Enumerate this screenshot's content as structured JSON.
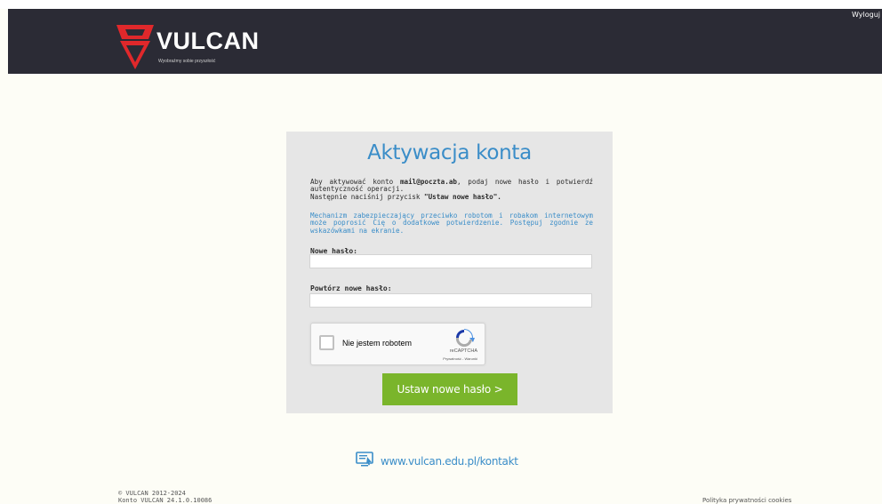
{
  "header": {
    "logout_label": "Wyloguj",
    "brand_name": "VULCAN",
    "brand_slogan": "Wyobraźmy sobie przyszłość"
  },
  "card": {
    "title": "Aktywacja konta",
    "intro_part1": "Aby aktywować konto ",
    "intro_email": "mail@poczta.ab",
    "intro_part2": ", podaj nowe hasło i potwierdź autentyczność operacji.",
    "intro_part3": "Następnie naciśnij przycisk ",
    "intro_button_ref": "\"Ustaw nowe hasło\".",
    "notice": "Mechanizm zabezpieczający przeciwko robotom i robakom internetowym może poprosić Cię o dodatkowe potwierdzenie. Postępuj zgodnie ze wskazówkami na ekranie.",
    "new_password_label": "Nowe hasło:",
    "new_password_value": "",
    "repeat_password_label": "Powtórz nowe hasło:",
    "repeat_password_value": "",
    "recaptcha": {
      "label": "Nie jestem robotem",
      "brand": "reCAPTCHA",
      "links": "Prywatność - Warunki"
    },
    "submit_label": "Ustaw nowe hasło >"
  },
  "contact": {
    "link_text": "www.vulcan.edu.pl/kontakt",
    "icon": "computer-monitor-icon"
  },
  "footer": {
    "copyright": "© VULCAN 2012-2024",
    "version": "Konto VULCAN 24.1.0.10086",
    "privacy_link": "Polityka prywatności cookies"
  },
  "colors": {
    "header_bg": "#2b2b35",
    "page_bg": "#fdfdf6",
    "card_bg": "#e6e6e6",
    "accent_blue": "#3a8dc8",
    "button_green": "#7ab52b",
    "logo_red": "#e0282b"
  }
}
